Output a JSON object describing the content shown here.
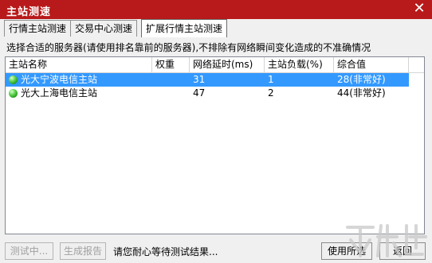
{
  "window": {
    "title": "主站测速",
    "close_icon": "close-icon"
  },
  "tabs": [
    {
      "label": "行情主站测速",
      "active": false
    },
    {
      "label": "交易中心测速",
      "active": false
    },
    {
      "label": "扩展行情主站测速",
      "active": true
    }
  ],
  "hint": "选择合适的服务器(请使用排名靠前的服务器),不排除有网络瞬间变化造成的不准确情况",
  "table": {
    "columns": [
      "主站名称",
      "权重",
      "网络延时(ms)",
      "主站负载(%)",
      "综合值"
    ],
    "rows": [
      {
        "name": "光大宁波电信主站",
        "weight": "",
        "latency": "31",
        "load": "1",
        "score": "28(非常好)",
        "selected": true,
        "status_icon": "green-status-icon"
      },
      {
        "name": "光大上海电信主站",
        "weight": "",
        "latency": "47",
        "load": "2",
        "score": "44(非常好)",
        "selected": false,
        "status_icon": "green-status-icon"
      }
    ]
  },
  "buttons": {
    "testing": "测试中...",
    "report": "生成报告",
    "use_selected": "使用所选",
    "back": "返回"
  },
  "status_text": "请您耐心等待测试结果..."
}
